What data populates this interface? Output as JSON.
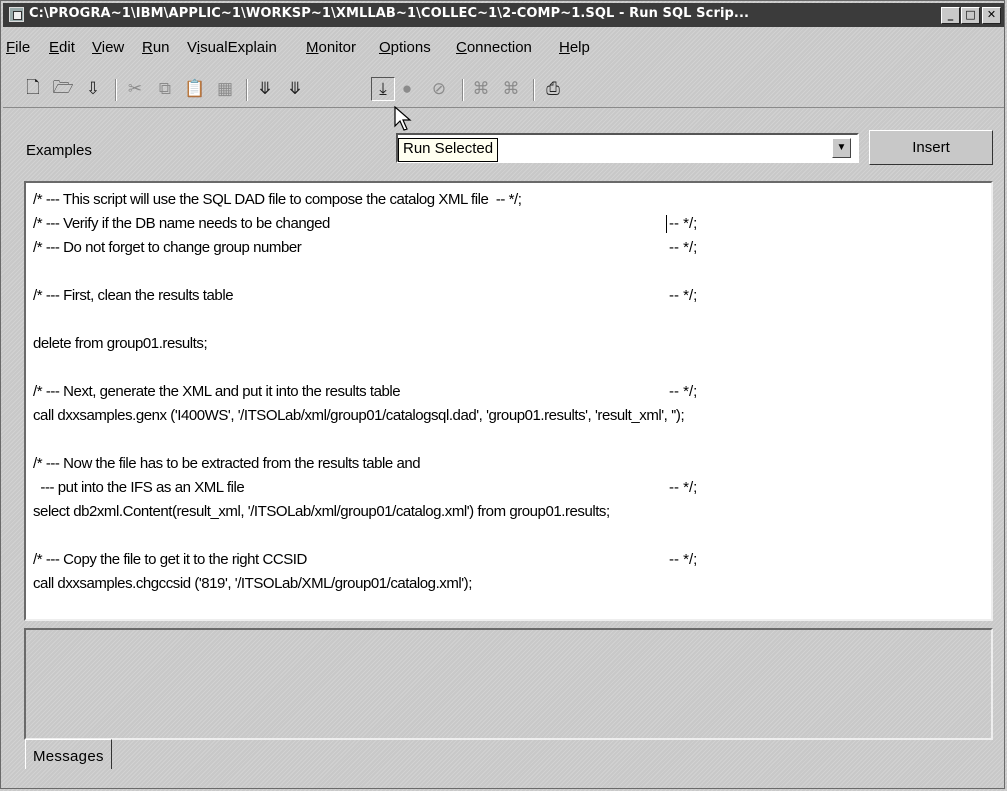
{
  "window": {
    "title": "C:\\PROGRA~1\\IBM\\APPLIC~1\\WORKSP~1\\XMLLAB~1\\COLLEC~1\\2-COMP~1.SQL - Run SQL Scrip...",
    "buttons": [
      "minimize",
      "maximize",
      "close"
    ]
  },
  "menu": [
    {
      "label": "File",
      "mnemonic": "F"
    },
    {
      "label": "Edit",
      "mnemonic": "E"
    },
    {
      "label": "View",
      "mnemonic": "V"
    },
    {
      "label": "Run",
      "mnemonic": "R"
    },
    {
      "label": "VisualExplain",
      "mnemonic": "i"
    },
    {
      "label": "Monitor",
      "mnemonic": "M"
    },
    {
      "label": "Options",
      "mnemonic": "O"
    },
    {
      "label": "Connection",
      "mnemonic": "C"
    },
    {
      "label": "Help",
      "mnemonic": "H"
    }
  ],
  "toolbar": {
    "icons": [
      "new-file-icon",
      "open-folder-icon",
      "save-icon",
      "cut-icon",
      "copy-icon",
      "paste-icon",
      "paste-special-icon",
      "run-all-icon",
      "run-from-selected-icon",
      "run-selected-icon",
      "stop-icon",
      "cancel-icon",
      "visual-explain-icon",
      "explain-icon",
      "print-icon"
    ],
    "tooltip": "Run Selected"
  },
  "examples": {
    "label": "Examples",
    "insert_label": "Insert"
  },
  "editor": {
    "lines": [
      "/* --- This script will use the SQL DAD file to compose the catalog XML file  -- */;",
      "/* --- Verify if the DB name needs to be changed",
      "/* --- Do not forget to change group number",
      "",
      "/* --- First, clean the results table",
      "",
      "delete from group01.results;",
      "",
      "/* --- Next, generate the XML and put it into the results table",
      "call dxxsamples.genx ('I400WS', '/ITSOLab/xml/group01/catalogsql.dad', 'group01.results', 'result_xml', '');",
      "",
      "/* --- Now the file has to be extracted from the results table and",
      "  --- put into the IFS as an XML file",
      "select db2xml.Content(result_xml, '/ITSOLab/xml/group01/catalog.xml') from group01.results;",
      "",
      "/* --- Copy the file to get it to the right CCSID",
      "call dxxsamples.chgccsid ('819', '/ITSOLab/XML/group01/catalog.xml');"
    ],
    "comment_ends": [
      "-- */;",
      "-- */;",
      "-- */;",
      "-- */;",
      "-- */;"
    ]
  },
  "messages": {
    "tab_label": "Messages"
  }
}
